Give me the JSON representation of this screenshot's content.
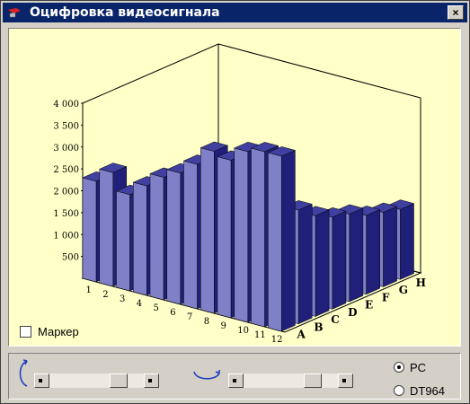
{
  "window": {
    "title": "Оцифровка видеосигнала",
    "close_label": "×"
  },
  "colors": {
    "titlebar": "#0a246a",
    "plot_background": "#ffffc8",
    "bar_face": "#8080c8",
    "bar_top": "#4040a0",
    "bar_side": "#20207a"
  },
  "chart_data": {
    "type": "bar3d",
    "y_ticks": [
      "4 000",
      "3 500",
      "3 000",
      "2 500",
      "2 000",
      "1 500",
      "1 000",
      "500"
    ],
    "x_labels": [
      "1",
      "2",
      "3",
      "4",
      "5",
      "6",
      "7",
      "8",
      "9",
      "10",
      "11",
      "12"
    ],
    "z_labels": [
      "A",
      "B",
      "C",
      "D",
      "E",
      "F",
      "G",
      "H"
    ],
    "ylim": [
      0,
      4000
    ]
  },
  "marker": {
    "label": "Маркер",
    "checked": false
  },
  "source_options": [
    {
      "label": "PC",
      "selected": true
    },
    {
      "label": "DT964",
      "selected": false
    }
  ],
  "icons": {
    "rotate_vertical": "rotate-vertical-icon",
    "rotate_horizontal": "rotate-horizontal-icon"
  }
}
